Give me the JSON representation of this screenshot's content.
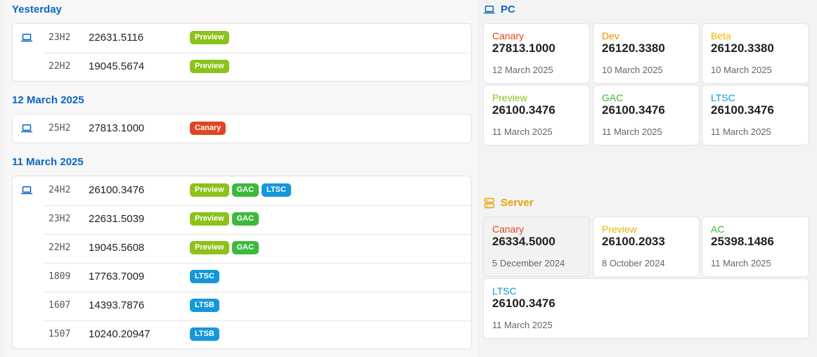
{
  "colors": {
    "accent": "#0a66c2",
    "canary": "#e0461e",
    "dev": "#f08c00",
    "beta": "#f0b400",
    "preview": "#8cc21a",
    "gac": "#3cb93c",
    "ltsc": "#1597db",
    "server_preview": "#e8b400"
  },
  "icons": {
    "pc": "laptop-icon",
    "server": "server-icon"
  },
  "timeline": [
    {
      "date": "Yesterday",
      "rows": [
        {
          "version": "23H2",
          "build": "22631.5116",
          "channels": [
            "Preview"
          ]
        },
        {
          "version": "22H2",
          "build": "19045.5674",
          "channels": [
            "Preview"
          ]
        }
      ]
    },
    {
      "date": "12 March 2025",
      "rows": [
        {
          "version": "25H2",
          "build": "27813.1000",
          "channels": [
            "Canary"
          ]
        }
      ]
    },
    {
      "date": "11 March 2025",
      "rows": [
        {
          "version": "24H2",
          "build": "26100.3476",
          "channels": [
            "Preview",
            "GAC",
            "LTSC"
          ]
        },
        {
          "version": "23H2",
          "build": "22631.5039",
          "channels": [
            "Preview",
            "GAC"
          ]
        },
        {
          "version": "22H2",
          "build": "19045.5608",
          "channels": [
            "Preview",
            "GAC"
          ]
        },
        {
          "version": "1809",
          "build": "17763.7009",
          "channels": [
            "LTSC"
          ]
        },
        {
          "version": "1607",
          "build": "14393.7876",
          "channels": [
            "LTSB"
          ]
        },
        {
          "version": "1507",
          "build": "10240.20947",
          "channels": [
            "LTSB"
          ]
        }
      ]
    }
  ],
  "pc": {
    "title": "PC",
    "tiles": [
      {
        "channel": "Canary",
        "build": "27813.1000",
        "date": "12 March 2025"
      },
      {
        "channel": "Dev",
        "build": "26120.3380",
        "date": "10 March 2025"
      },
      {
        "channel": "Beta",
        "build": "26120.3380",
        "date": "10 March 2025"
      },
      {
        "channel": "Preview",
        "build": "26100.3476",
        "date": "11 March 2025"
      },
      {
        "channel": "GAC",
        "build": "26100.3476",
        "date": "11 March 2025"
      },
      {
        "channel": "LTSC",
        "build": "26100.3476",
        "date": "11 March 2025"
      }
    ]
  },
  "server": {
    "title": "Server",
    "tiles": [
      {
        "channel": "Canary",
        "build": "26334.5000",
        "date": "5 December 2024"
      },
      {
        "channel": "Preview",
        "build": "26100.2033",
        "date": "8 October 2024"
      },
      {
        "channel": "AC",
        "build": "25398.1486",
        "date": "11 March 2025"
      },
      {
        "channel": "LTSC",
        "build": "26100.3476",
        "date": "11 March 2025"
      }
    ]
  }
}
